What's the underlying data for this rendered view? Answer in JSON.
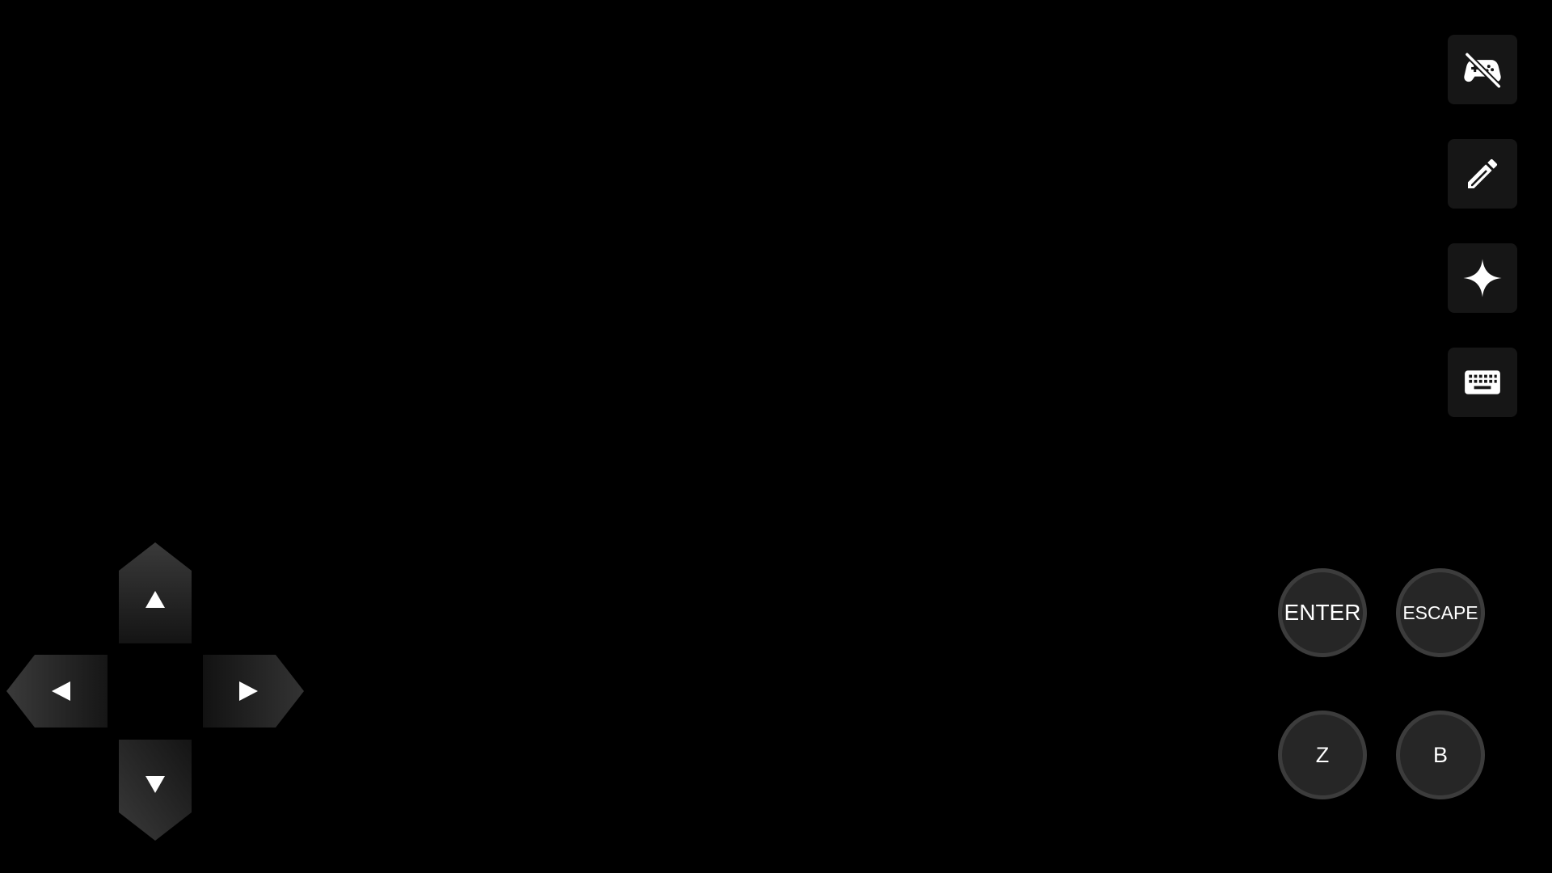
{
  "toolbar": {
    "items": [
      {
        "icon": "gamepad-off-icon"
      },
      {
        "icon": "pencil-icon"
      },
      {
        "icon": "four-point-star-icon"
      },
      {
        "icon": "keyboard-icon"
      }
    ]
  },
  "dpad": {
    "up_icon": "triangle-up-icon",
    "down_icon": "triangle-down-icon",
    "left_icon": "triangle-left-icon",
    "right_icon": "triangle-right-icon"
  },
  "buttons": {
    "enter": "ENTER",
    "escape": "ESCAPE",
    "z": "Z",
    "b": "B"
  },
  "colors": {
    "background": "#000000",
    "toolbar_button": "#161616",
    "dpad_key_light": "#3a3a3a",
    "dpad_key_dark": "#141414",
    "action_fill": "#262626",
    "action_ring": "#3c3c3c",
    "glyph": "#ffffff"
  }
}
